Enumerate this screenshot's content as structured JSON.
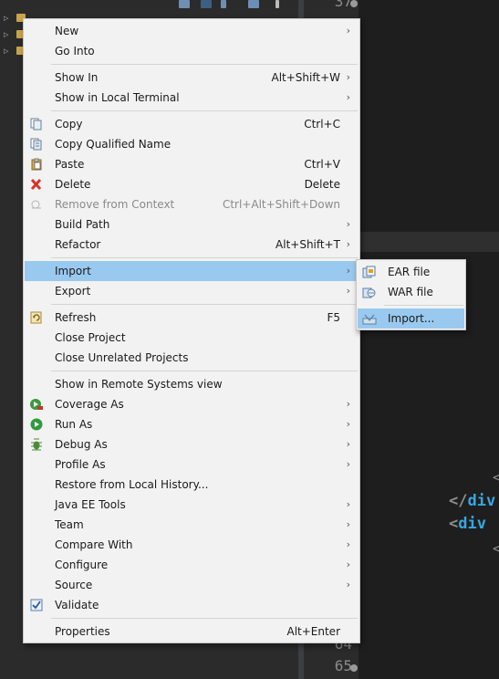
{
  "editor": {
    "line_numbers": [
      "37",
      "64",
      "65"
    ],
    "code_lines": [
      {
        "bracket": "</",
        "tag": "div"
      },
      {
        "bracket": "<",
        "tag": "div"
      }
    ],
    "tag_color": "#35a8e0"
  },
  "context_menu": {
    "highlight_color": "#99c9ef",
    "items": [
      {
        "label": "New",
        "shortcut": "",
        "submenu": true,
        "icon": "none"
      },
      {
        "label": "Go Into",
        "shortcut": "",
        "submenu": false,
        "icon": "none"
      },
      {
        "label": "Show In",
        "shortcut": "Alt+Shift+W",
        "submenu": true,
        "icon": "none"
      },
      {
        "label": "Show in Local Terminal",
        "shortcut": "",
        "submenu": true,
        "icon": "none"
      },
      {
        "label": "Copy",
        "shortcut": "Ctrl+C",
        "submenu": false,
        "icon": "copy-icon"
      },
      {
        "label": "Copy Qualified Name",
        "shortcut": "",
        "submenu": false,
        "icon": "copy-qualified-name-icon"
      },
      {
        "label": "Paste",
        "shortcut": "Ctrl+V",
        "submenu": false,
        "icon": "paste-icon"
      },
      {
        "label": "Delete",
        "shortcut": "Delete",
        "submenu": false,
        "icon": "delete-icon"
      },
      {
        "label": "Remove from Context",
        "shortcut": "Ctrl+Alt+Shift+Down",
        "submenu": false,
        "icon": "remove-context-icon",
        "disabled": true
      },
      {
        "label": "Build Path",
        "shortcut": "",
        "submenu": true,
        "icon": "none"
      },
      {
        "label": "Refactor",
        "shortcut": "Alt+Shift+T",
        "submenu": true,
        "icon": "none"
      },
      {
        "label": "Import",
        "shortcut": "",
        "submenu": true,
        "icon": "none",
        "highlighted": true
      },
      {
        "label": "Export",
        "shortcut": "",
        "submenu": true,
        "icon": "none"
      },
      {
        "label": "Refresh",
        "shortcut": "F5",
        "submenu": false,
        "icon": "refresh-icon"
      },
      {
        "label": "Close Project",
        "shortcut": "",
        "submenu": false,
        "icon": "none"
      },
      {
        "label": "Close Unrelated Projects",
        "shortcut": "",
        "submenu": false,
        "icon": "none"
      },
      {
        "label": "Show in Remote Systems view",
        "shortcut": "",
        "submenu": false,
        "icon": "none"
      },
      {
        "label": "Coverage As",
        "shortcut": "",
        "submenu": true,
        "icon": "coverage-icon"
      },
      {
        "label": "Run As",
        "shortcut": "",
        "submenu": true,
        "icon": "run-icon"
      },
      {
        "label": "Debug As",
        "shortcut": "",
        "submenu": true,
        "icon": "debug-bug-icon"
      },
      {
        "label": "Profile As",
        "shortcut": "",
        "submenu": true,
        "icon": "none"
      },
      {
        "label": "Restore from Local History...",
        "shortcut": "",
        "submenu": false,
        "icon": "none"
      },
      {
        "label": "Java EE Tools",
        "shortcut": "",
        "submenu": true,
        "icon": "none"
      },
      {
        "label": "Team",
        "shortcut": "",
        "submenu": true,
        "icon": "none"
      },
      {
        "label": "Compare With",
        "shortcut": "",
        "submenu": true,
        "icon": "none"
      },
      {
        "label": "Configure",
        "shortcut": "",
        "submenu": true,
        "icon": "none"
      },
      {
        "label": "Source",
        "shortcut": "",
        "submenu": true,
        "icon": "none"
      },
      {
        "label": "Validate",
        "shortcut": "",
        "submenu": false,
        "icon": "checkbox-checked-icon"
      },
      {
        "label": "Properties",
        "shortcut": "Alt+Enter",
        "submenu": false,
        "icon": "none"
      }
    ]
  },
  "import_submenu": {
    "items": [
      {
        "label": "EAR file",
        "icon": "ear-file-icon"
      },
      {
        "label": "WAR file",
        "icon": "war-file-icon"
      },
      {
        "label": "Import...",
        "icon": "import-wizard-icon",
        "highlighted": true
      }
    ]
  }
}
